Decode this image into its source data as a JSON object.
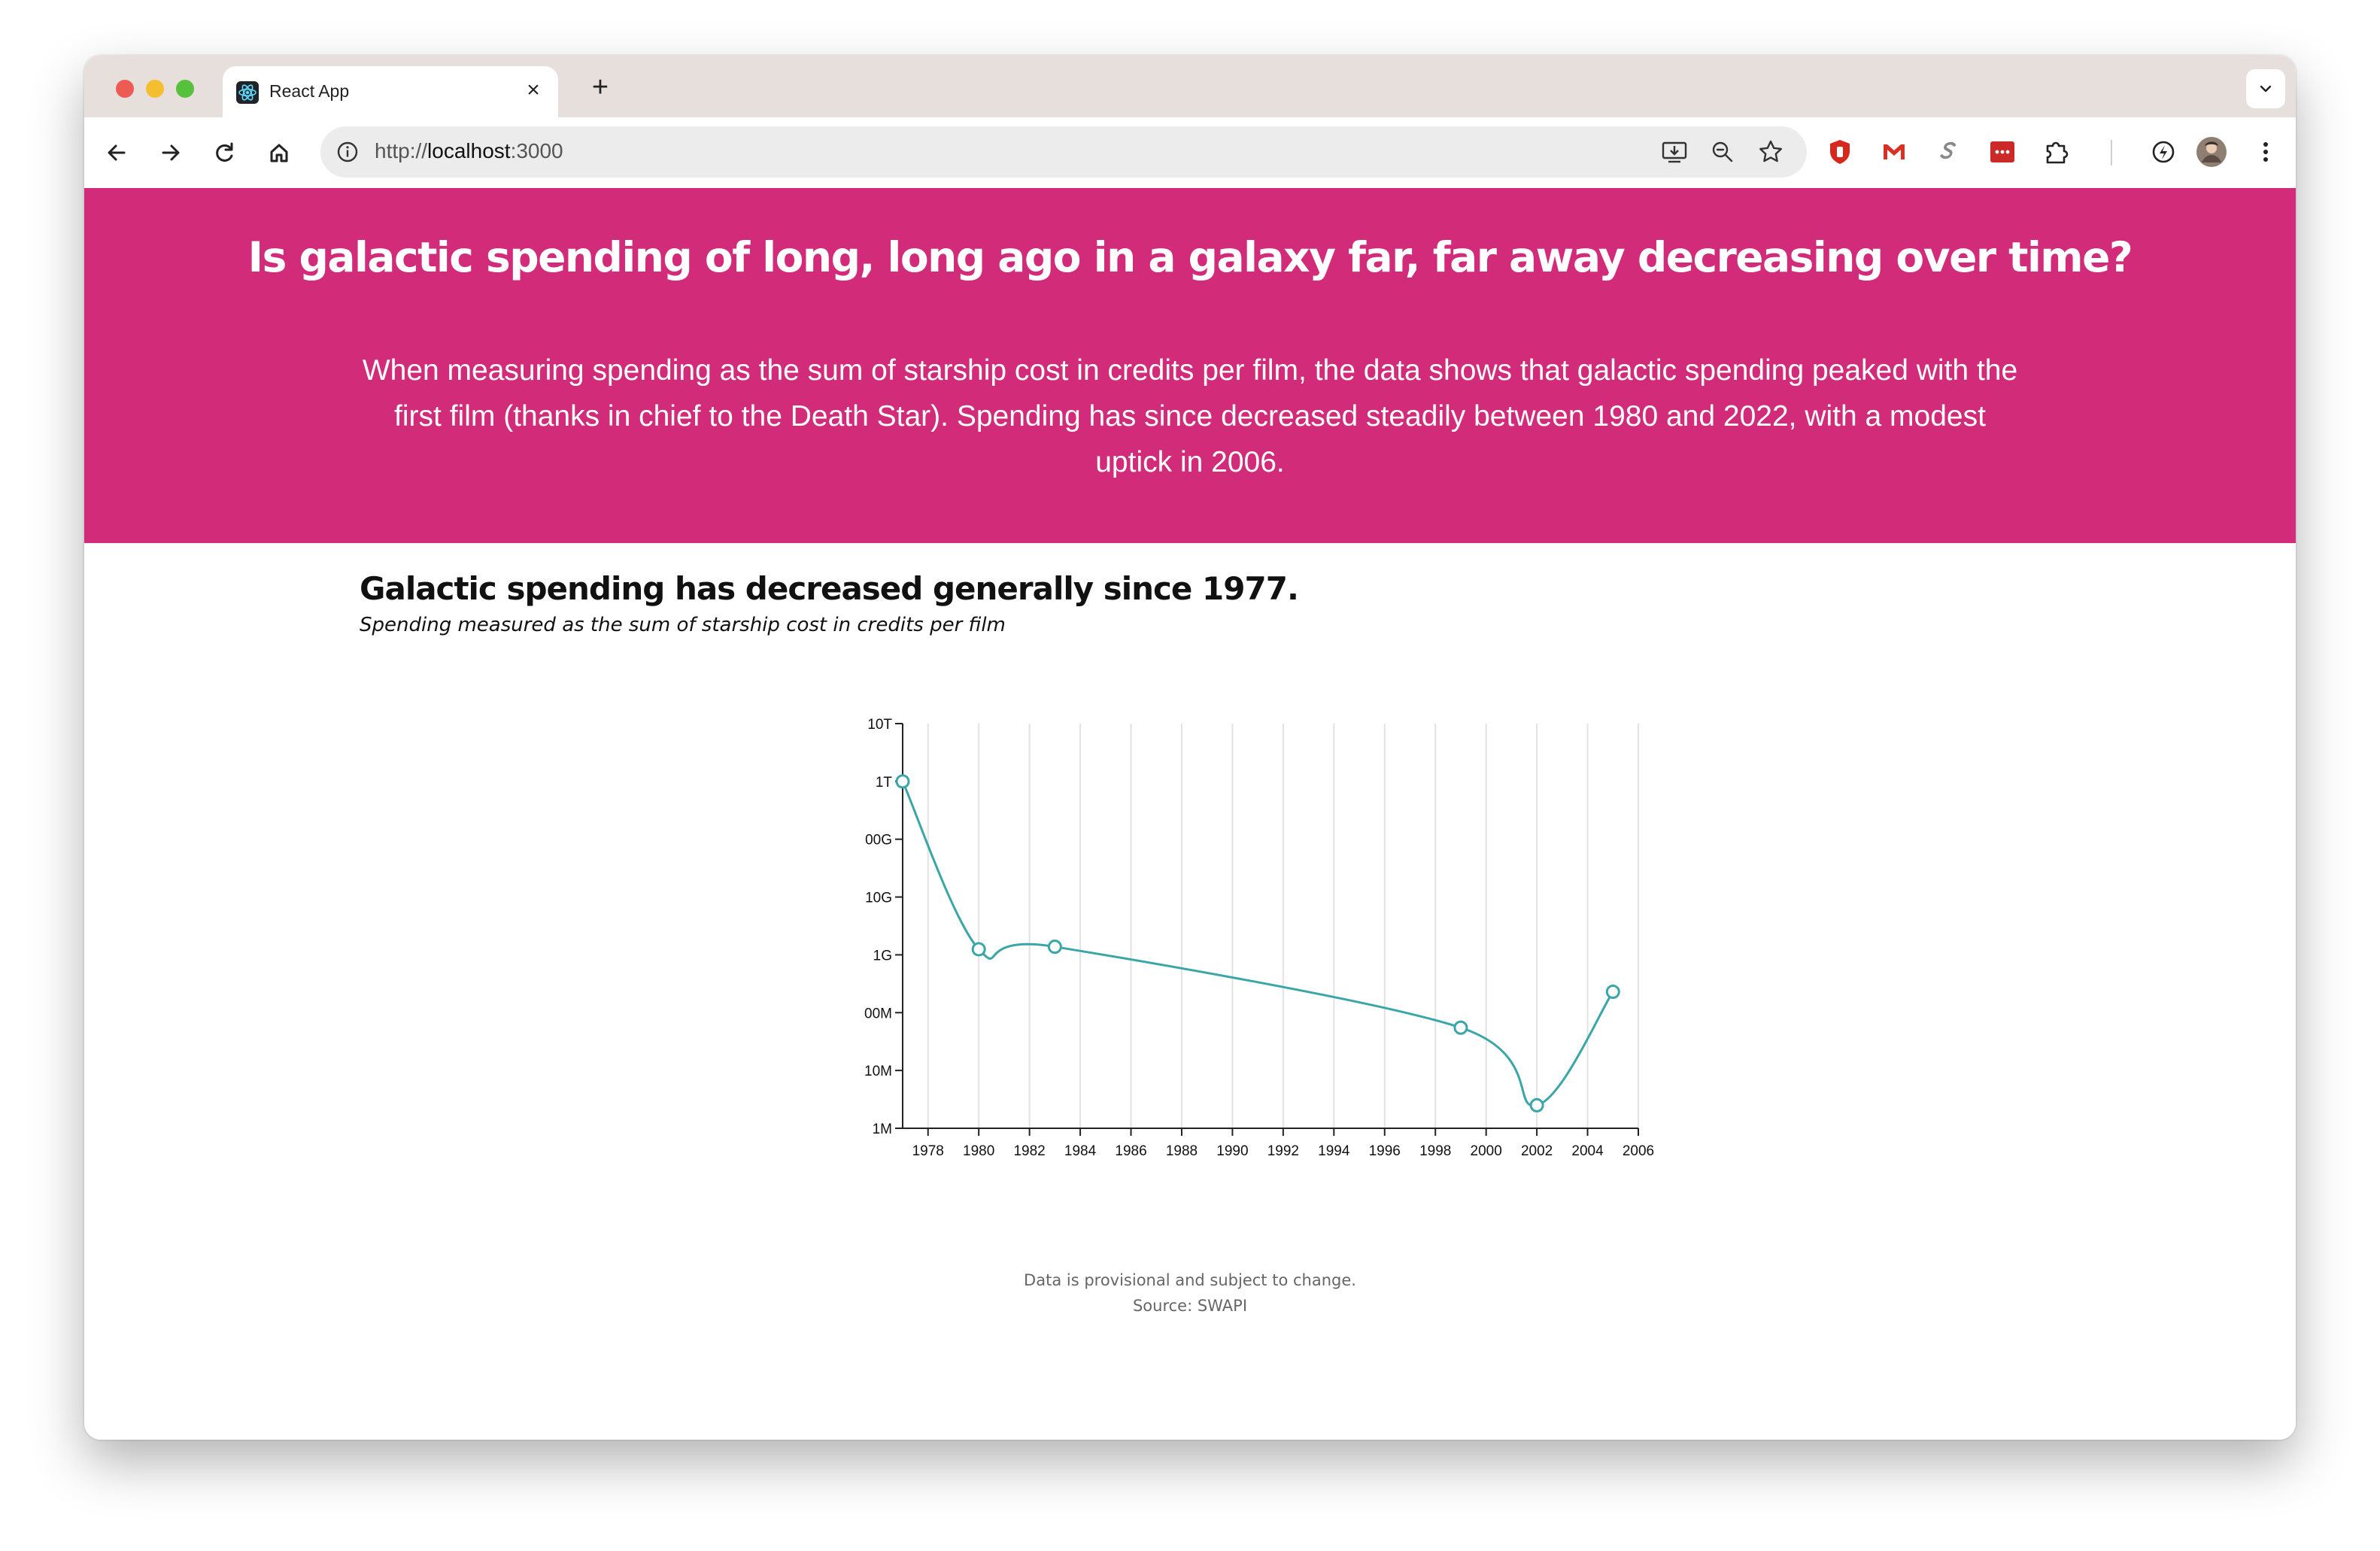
{
  "browser": {
    "tab_title": "React App",
    "tab_close": "×",
    "new_tab": "+",
    "url_scheme": "http://",
    "url_host": "localhost",
    "url_port": ":3000"
  },
  "hero": {
    "title": "Is galactic spending of long, long ago in a galaxy far, far away decreasing over time?",
    "description": "When measuring spending as the sum of starship cost in credits per film, the data shows that galactic spending peaked with the first film (thanks in chief to the Death Star). Spending has since decreased steadily between 1980 and 2022, with a modest uptick in 2006.",
    "background": "#d12b7a"
  },
  "chart": {
    "title": "Galactic spending has decreased generally since 1977.",
    "subtitle": "Spending measured as the sum of starship cost in credits per film",
    "note": "Data is provisional and subject to change.",
    "source": "Source: SWAPI"
  },
  "chart_data": {
    "type": "line",
    "scale_y": "log",
    "x": [
      1977,
      1980,
      1983,
      1999,
      2002,
      2005
    ],
    "series": [
      {
        "values": [
          1000000000000,
          1250000000,
          1380000000,
          55000000,
          2500000,
          230000000
        ]
      }
    ],
    "xlim": [
      1977,
      2006
    ],
    "ylim": [
      1000000,
      10000000000000
    ],
    "x_ticks": [
      1978,
      1980,
      1982,
      1984,
      1986,
      1988,
      1990,
      1992,
      1994,
      1996,
      1998,
      2000,
      2002,
      2004,
      2006
    ],
    "y_ticks": [
      1000000,
      10000000,
      100000000,
      1000000000,
      10000000000,
      100000000000,
      1000000000000,
      10000000000000
    ],
    "y_tick_labels": [
      "1M",
      "10M",
      "00M",
      "1G",
      "10G",
      "00G",
      "1T",
      "10T"
    ],
    "grid": "vertical",
    "line_color": "#3aa6a8"
  }
}
